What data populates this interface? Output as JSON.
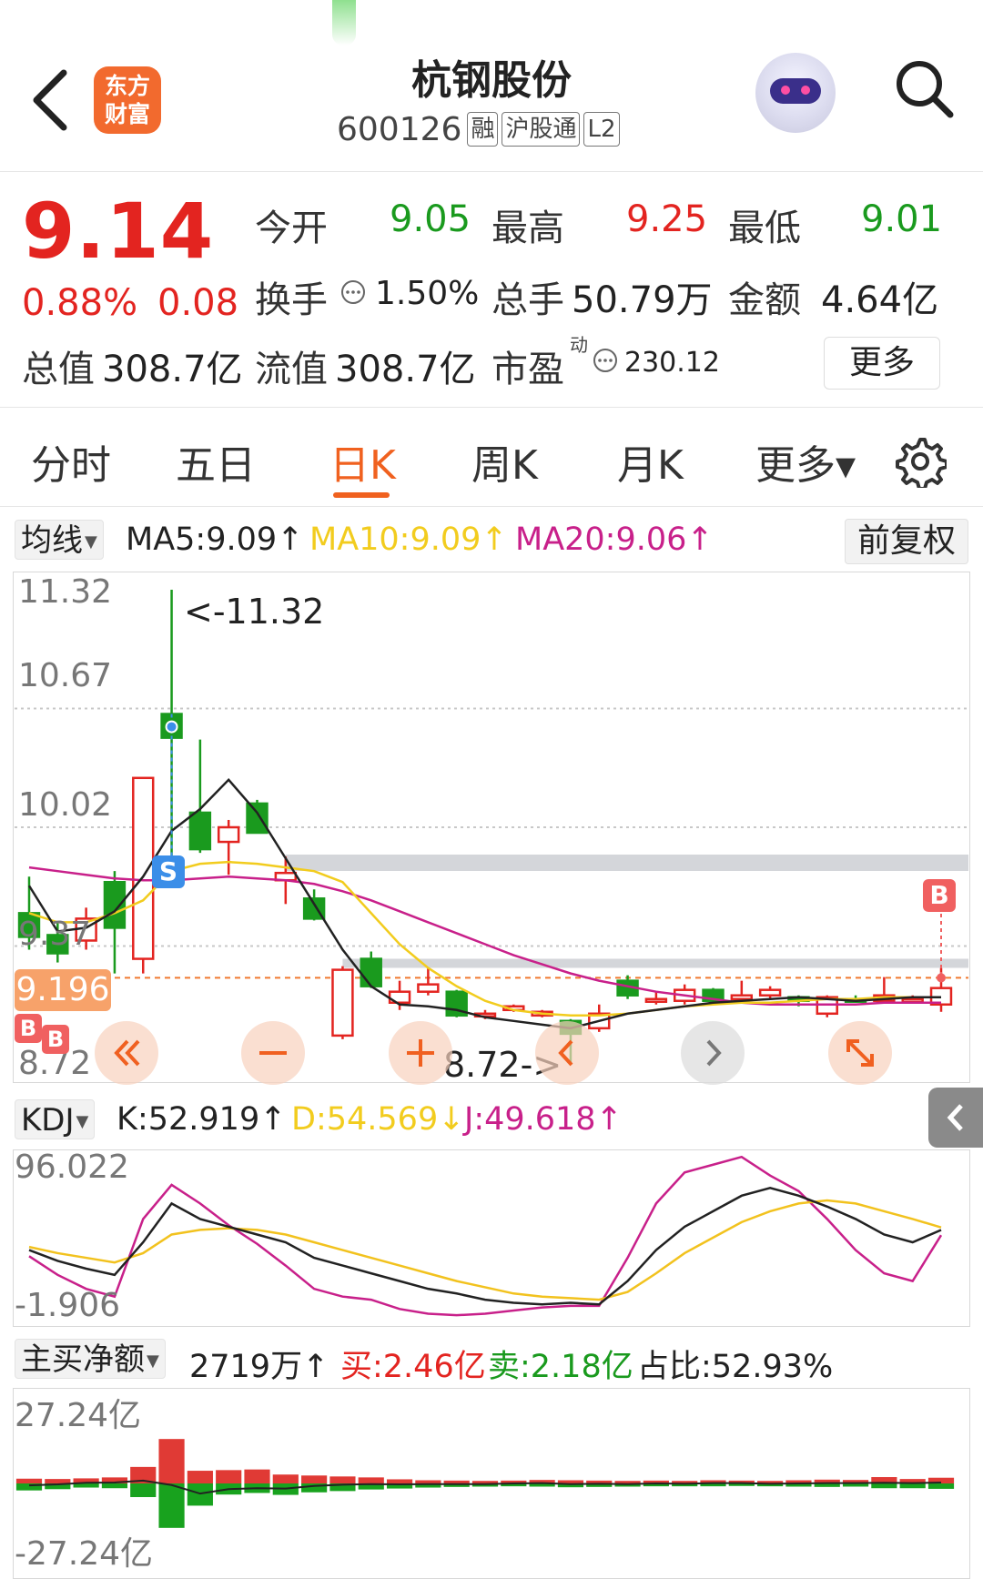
{
  "header": {
    "stock_name": "杭钢股份",
    "stock_code": "600126",
    "tags": [
      "融",
      "沪股通",
      "L2"
    ],
    "logo_text_line1": "东方",
    "logo_text_line2": "财富"
  },
  "quote": {
    "price": "9.14",
    "change_pct": "0.88%",
    "change_amt": "0.08",
    "open_label": "今开",
    "open_value": "9.05",
    "high_label": "最高",
    "high_value": "9.25",
    "low_label": "最低",
    "low_value": "9.01",
    "turnover_label": "换手",
    "turnover_value": "1.50%",
    "volume_label": "总手",
    "volume_value": "50.79万",
    "amount_label": "金额",
    "amount_value": "4.64亿",
    "mktcap_label": "总值",
    "mktcap_value": "308.7亿",
    "float_label": "流值",
    "float_value": "308.7亿",
    "pe_label": "市盈",
    "pe_sup": "动",
    "pe_value": "230.12",
    "more_button": "更多"
  },
  "tabs": [
    {
      "label": "分时"
    },
    {
      "label": "五日"
    },
    {
      "label": "日K"
    },
    {
      "label": "周K"
    },
    {
      "label": "月K"
    },
    {
      "label": "更多▾"
    }
  ],
  "main_chart": {
    "selector": "均线",
    "ma5": "MA5:9.09↑",
    "ma10": "MA10:9.09↑",
    "ma20": "MA20:9.06↑",
    "fuquan": "前复权",
    "y_labels": [
      "11.32",
      "10.67",
      "10.02",
      "9.37",
      "8.72"
    ],
    "current_price_tag": "9.196",
    "max_annotation": "<-11.32",
    "min_annotation": "8.72->",
    "colors": {
      "ma5": "#222222",
      "ma10": "#f2cc1e",
      "ma20": "#c8208a",
      "up": "#e32420",
      "down": "#1a9a1e"
    }
  },
  "kdj": {
    "selector": "KDJ",
    "k": "K:52.919↑",
    "d": "D:54.569↓",
    "j": "J:49.618↑",
    "y_top": "96.022",
    "y_bottom": "-1.906"
  },
  "flow": {
    "selector": "主买净额",
    "net": "2719万↑",
    "buy": "买:2.46亿",
    "sell": "卖:2.18亿",
    "ratio": "占比:52.93%",
    "y_top": "27.24亿",
    "y_bottom": "-27.24亿"
  },
  "chart_data": {
    "type": "candlestick",
    "ylim": [
      8.72,
      11.32
    ],
    "candles": [
      {
        "o": 9.55,
        "c": 9.42,
        "h": 9.75,
        "l": 9.35
      },
      {
        "o": 9.43,
        "c": 9.33,
        "h": 9.5,
        "l": 9.28
      },
      {
        "o": 9.4,
        "c": 9.52,
        "h": 9.58,
        "l": 9.35
      },
      {
        "o": 9.72,
        "c": 9.47,
        "h": 9.78,
        "l": 9.22
      },
      {
        "o": 9.3,
        "c": 10.29,
        "h": 10.29,
        "l": 9.22
      },
      {
        "o": 10.64,
        "c": 10.51,
        "h": 11.32,
        "l": 9.77
      },
      {
        "o": 10.1,
        "c": 9.9,
        "h": 10.5,
        "l": 9.88
      },
      {
        "o": 9.94,
        "c": 10.02,
        "h": 10.06,
        "l": 9.76
      },
      {
        "o": 10.15,
        "c": 9.99,
        "h": 10.17,
        "l": 9.99
      },
      {
        "o": 9.73,
        "c": 9.77,
        "h": 9.86,
        "l": 9.6
      },
      {
        "o": 9.63,
        "c": 9.52,
        "h": 9.68,
        "l": 9.51
      },
      {
        "o": 8.88,
        "c": 9.24,
        "h": 9.26,
        "l": 8.86
      },
      {
        "o": 9.3,
        "c": 9.15,
        "h": 9.34,
        "l": 9.14
      },
      {
        "o": 9.06,
        "c": 9.12,
        "h": 9.18,
        "l": 9.02
      },
      {
        "o": 9.12,
        "c": 9.16,
        "h": 9.25,
        "l": 9.1
      },
      {
        "o": 9.12,
        "c": 8.99,
        "h": 9.13,
        "l": 8.98
      },
      {
        "o": 9.0,
        "c": 9.0,
        "h": 9.02,
        "l": 8.97
      },
      {
        "o": 9.02,
        "c": 9.04,
        "h": 9.05,
        "l": 9.01
      },
      {
        "o": 8.99,
        "c": 9.01,
        "h": 9.02,
        "l": 8.98
      },
      {
        "o": 8.96,
        "c": 8.89,
        "h": 8.97,
        "l": 8.72
      },
      {
        "o": 8.92,
        "c": 9.0,
        "h": 9.05,
        "l": 8.9
      },
      {
        "o": 9.18,
        "c": 9.1,
        "h": 9.21,
        "l": 9.08
      },
      {
        "o": 9.08,
        "c": 9.08,
        "h": 9.12,
        "l": 9.05
      },
      {
        "o": 9.07,
        "c": 9.13,
        "h": 9.16,
        "l": 9.05
      },
      {
        "o": 9.13,
        "c": 9.07,
        "h": 9.14,
        "l": 9.05
      },
      {
        "o": 9.08,
        "c": 9.1,
        "h": 9.18,
        "l": 9.06
      },
      {
        "o": 9.1,
        "c": 9.13,
        "h": 9.15,
        "l": 9.08
      },
      {
        "o": 9.09,
        "c": 9.07,
        "h": 9.1,
        "l": 9.04
      },
      {
        "o": 9.0,
        "c": 9.09,
        "h": 9.1,
        "l": 8.98
      },
      {
        "o": 9.08,
        "c": 9.07,
        "h": 9.1,
        "l": 9.06
      },
      {
        "o": 9.07,
        "c": 9.1,
        "h": 9.2,
        "l": 9.06
      },
      {
        "o": 9.08,
        "c": 9.08,
        "h": 9.1,
        "l": 9.06
      },
      {
        "o": 9.05,
        "c": 9.14,
        "h": 9.25,
        "l": 9.01
      }
    ],
    "ma5": [
      9.7,
      9.45,
      9.47,
      9.56,
      9.75,
      10.0,
      10.12,
      10.28,
      10.1,
      9.85,
      9.6,
      9.35,
      9.15,
      9.05,
      9.04,
      9.02,
      8.98,
      8.96,
      8.94,
      8.92,
      8.96,
      9.0,
      9.02,
      9.04,
      9.06,
      9.07,
      9.08,
      9.09,
      9.08,
      9.07,
      9.08,
      9.09,
      9.09
    ],
    "ma10": [
      9.55,
      9.5,
      9.5,
      9.55,
      9.62,
      9.78,
      9.82,
      9.83,
      9.82,
      9.8,
      9.78,
      9.72,
      9.55,
      9.38,
      9.25,
      9.15,
      9.07,
      9.02,
      9.0,
      8.99,
      8.99,
      9.0,
      9.02,
      9.04,
      9.05,
      9.06,
      9.06,
      9.07,
      9.08,
      9.08,
      9.09,
      9.09,
      9.09
    ],
    "ma20": [
      9.8,
      9.78,
      9.76,
      9.74,
      9.73,
      9.73,
      9.74,
      9.75,
      9.74,
      9.73,
      9.71,
      9.67,
      9.62,
      9.56,
      9.5,
      9.44,
      9.38,
      9.32,
      9.27,
      9.22,
      9.18,
      9.15,
      9.12,
      9.1,
      9.08,
      9.06,
      9.05,
      9.05,
      9.05,
      9.05,
      9.06,
      9.06,
      9.06
    ],
    "kdj": {
      "ylim": [
        -1.906,
        96.022
      ],
      "K": [
        40,
        33,
        28,
        24,
        45,
        70,
        60,
        55,
        50,
        45,
        35,
        30,
        25,
        20,
        15,
        12,
        8,
        6,
        5,
        6,
        5,
        20,
        40,
        55,
        65,
        75,
        80,
        75,
        68,
        60,
        50,
        45,
        52.9
      ],
      "D": [
        42,
        38,
        35,
        32,
        38,
        50,
        53,
        54,
        53,
        50,
        45,
        40,
        35,
        30,
        25,
        20,
        16,
        12,
        10,
        9,
        8,
        13,
        25,
        38,
        48,
        58,
        65,
        70,
        72,
        70,
        65,
        60,
        54.6
      ],
      "J": [
        36,
        24,
        15,
        10,
        60,
        82,
        70,
        56,
        44,
        30,
        15,
        10,
        8,
        2,
        -1,
        -2,
        -1,
        1,
        3,
        4,
        4,
        35,
        70,
        90,
        95,
        100,
        88,
        78,
        60,
        40,
        25,
        20,
        49.6
      ]
    },
    "net_flow": {
      "ylim": [
        -27.24,
        27.24
      ],
      "buy": [
        1.5,
        1.4,
        1.6,
        1.9,
        5.2,
        14.0,
        4.0,
        4.2,
        4.4,
        2.8,
        2.5,
        2.2,
        1.9,
        1.3,
        1.0,
        0.9,
        0.8,
        0.9,
        1.1,
        1.0,
        0.9,
        0.8,
        0.9,
        0.8,
        1.0,
        0.9,
        0.8,
        1.0,
        1.2,
        1.1,
        2.0,
        1.4,
        1.8
      ],
      "sell": [
        2.2,
        1.8,
        1.3,
        1.5,
        4.3,
        14.0,
        7.0,
        3.5,
        3.0,
        3.6,
        2.8,
        2.4,
        1.9,
        1.6,
        1.3,
        1.1,
        1.0,
        0.9,
        1.0,
        1.2,
        1.1,
        1.0,
        0.9,
        0.9,
        0.9,
        0.8,
        0.9,
        1.0,
        1.1,
        1.0,
        1.5,
        1.5,
        1.7
      ],
      "net": [
        -0.6,
        -0.3,
        0.2,
        0.3,
        0.9,
        -0.5,
        -3.2,
        -1.8,
        -1.5,
        -1.6,
        -0.8,
        -0.4,
        -0.2,
        -0.3,
        -0.2,
        -0.2,
        -0.2,
        0,
        0.1,
        -0.2,
        -0.1,
        -0.2,
        0,
        -0.1,
        0.1,
        0.1,
        -0.1,
        0,
        0.1,
        0.1,
        0.2,
        0.1,
        0.27
      ]
    }
  }
}
